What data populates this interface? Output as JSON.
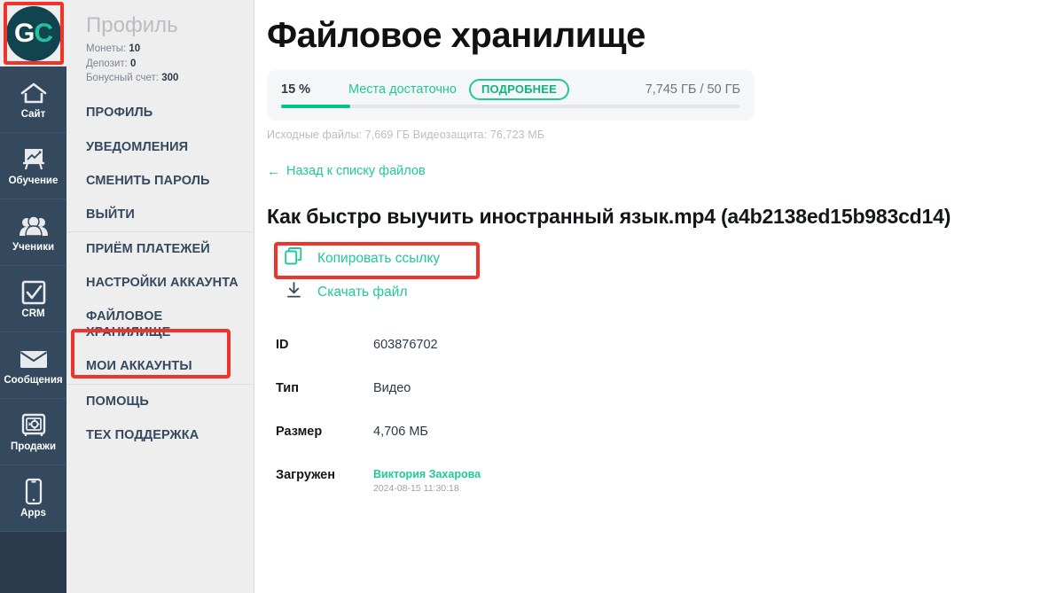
{
  "rail": {
    "logo": {
      "text_g": "G",
      "text_c": "C",
      "highlight_color": "#f0342b"
    },
    "items": [
      {
        "label": "Сайт",
        "icon": "home-icon"
      },
      {
        "label": "Обучение",
        "icon": "easel-chart-icon"
      },
      {
        "label": "Ученики",
        "icon": "people-icon"
      },
      {
        "label": "CRM",
        "icon": "checkbox-check-icon"
      },
      {
        "label": "Сообщения",
        "icon": "envelope-icon"
      },
      {
        "label": "Продажи",
        "icon": "safe-vault-icon"
      },
      {
        "label": "Apps",
        "icon": "mobile-phone-icon"
      }
    ]
  },
  "menu": {
    "profile": {
      "title": "Профиль",
      "coins_label": "Монеты:",
      "coins_value": "10",
      "deposit_label": "Депозит:",
      "deposit_value": "0",
      "bonus_label": "Бонусный счет:",
      "bonus_value": "300"
    },
    "items": [
      {
        "label": "ПРОФИЛЬ",
        "separator": false
      },
      {
        "label": "УВЕДОМЛЕНИЯ",
        "separator": false
      },
      {
        "label": "СМЕНИТЬ ПАРОЛЬ",
        "separator": false
      },
      {
        "label": "ВЫЙТИ",
        "separator": false
      },
      {
        "label": "ПРИЁМ ПЛАТЕЖЕЙ",
        "separator": true
      },
      {
        "label": "НАСТРОЙКИ АККАУНТА",
        "separator": false
      },
      {
        "label": "ФАЙЛОВОЕ ХРАНИЛИЩЕ",
        "separator": false
      },
      {
        "label": "МОИ АККАУНТЫ",
        "separator": false
      },
      {
        "label": "ПОМОЩЬ",
        "separator": true
      },
      {
        "label": "ТЕХ ПОДДЕРЖКА",
        "separator": false
      }
    ]
  },
  "main": {
    "page_title": "Файловое хранилище",
    "storage": {
      "percent": "15 %",
      "status": "Места достаточно",
      "more_button": "ПОДРОБНЕЕ",
      "amount": "7,745 ГБ / 50 ГБ",
      "fill_percent": 15,
      "fill_color": "#00c389",
      "sub_line": "Исходные файлы: 7,669 ГБ Видеозащита: 76,723 МБ"
    },
    "back_link": {
      "arrow": "←",
      "label": "Назад к списку файлов"
    },
    "file_title": "Как быстро выучить иностранный язык.mp4 (a4b2138ed15b983cd14)",
    "actions": [
      {
        "label": "Копировать ссылку",
        "icon": "copy-icon",
        "highlighted": true
      },
      {
        "label": "Скачать файл",
        "icon": "download-icon",
        "highlighted": false
      }
    ],
    "meta": [
      {
        "key": "ID",
        "value": "603876702"
      },
      {
        "key": "Тип",
        "value": "Видео"
      },
      {
        "key": "Размер",
        "value": "4,706 МБ"
      },
      {
        "key": "Загружен",
        "value": "Виктория Захарова",
        "sub": "2024-08-15 11:30:18",
        "is_link": true
      }
    ]
  }
}
